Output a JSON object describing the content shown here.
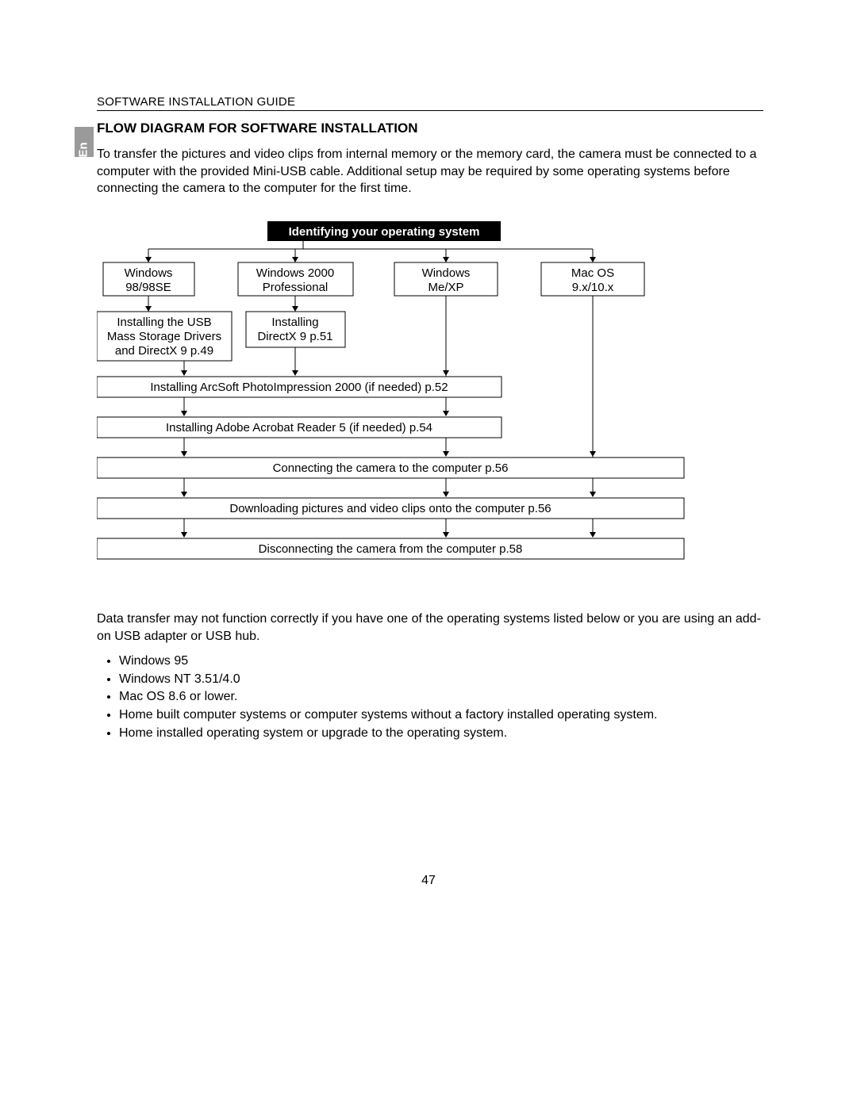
{
  "lang_tab": "En",
  "header": "SOFTWARE INSTALLATION GUIDE",
  "section_title": "FLOW DIAGRAM FOR SOFTWARE INSTALLATION",
  "intro": "To transfer the pictures and video clips from internal memory or the memory card, the camera must be connected to a computer with the provided Mini-USB cable.  Additional setup may be required by some operating systems before connecting the camera to the computer for the first time.",
  "diagram": {
    "header": "Identifying your operating system",
    "os": {
      "win9x_l1": "Windows",
      "win9x_l2": "98/98SE",
      "win2k_l1": "Windows 2000",
      "win2k_l2": "Professional",
      "winme_l1": "Windows",
      "winme_l2": "Me/XP",
      "mac_l1": "Mac OS",
      "mac_l2": "9.x/10.x"
    },
    "usb_l1": "Installing the USB",
    "usb_l2": "Mass Storage Drivers",
    "usb_l3": "and DirectX 9 p.49",
    "dx_l1": "Installing",
    "dx_l2": "DirectX 9 p.51",
    "arcsoft": "Installing ArcSoft PhotoImpression 2000 (if needed) p.52",
    "adobe": "Installing Adobe Acrobat Reader 5 (if needed) p.54",
    "connect": "Connecting the camera to the computer p.56",
    "download": "Downloading pictures and video clips onto the computer p.56",
    "disconnect": "Disconnecting the camera from the computer p.58"
  },
  "after_text": "Data transfer may not function correctly if you have one of the operating systems listed below or you are using an add-on USB adapter or USB hub.",
  "unsupported": {
    "i1": "Windows 95",
    "i2": "Windows NT 3.51/4.0",
    "i3": "Mac OS 8.6 or lower.",
    "i4": "Home built computer systems or computer systems without a factory installed operating system.",
    "i5": "Home installed operating system or upgrade to the operating system."
  },
  "page_number": "47"
}
